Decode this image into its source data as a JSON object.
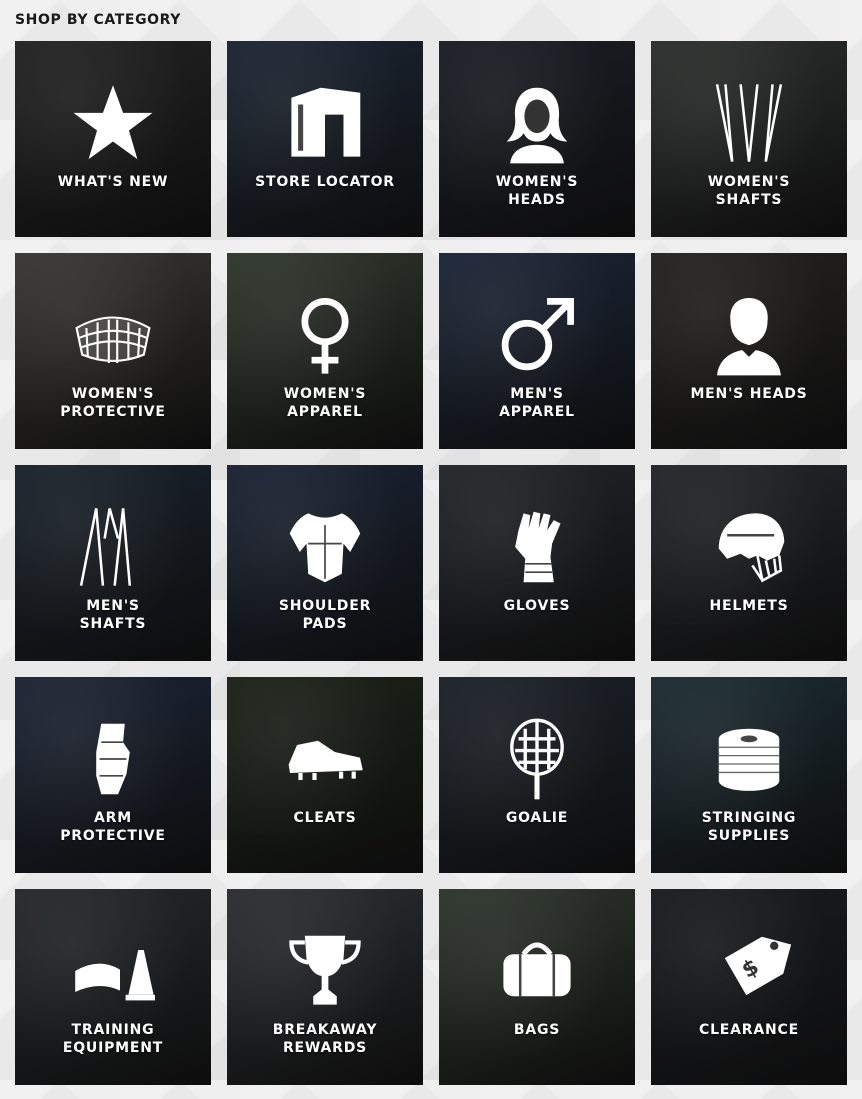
{
  "section_title": "SHOP BY CATEGORY",
  "categories": [
    {
      "label": "WHAT'S NEW",
      "icon": "star-icon",
      "bg": "#3a3a3a"
    },
    {
      "label": "STORE LOCATOR",
      "icon": "storefront-icon",
      "bg": "#2f3e55"
    },
    {
      "label": "WOMEN'S\nHEADS",
      "icon": "woman-head-icon",
      "bg": "#2e3240"
    },
    {
      "label": "WOMEN'S\nSHAFTS",
      "icon": "women-shafts-icon",
      "bg": "#4a4e4c"
    },
    {
      "label": "WOMEN'S\nPROTECTIVE",
      "icon": "goggles-icon",
      "bg": "#5e5a55"
    },
    {
      "label": "WOMEN'S\nAPPAREL",
      "icon": "female-symbol-icon",
      "bg": "#4f5b4a"
    },
    {
      "label": "MEN'S\nAPPAREL",
      "icon": "male-symbol-icon",
      "bg": "#2f3f5e"
    },
    {
      "label": "MEN'S HEADS",
      "icon": "man-head-icon",
      "bg": "#3d3a37"
    },
    {
      "label": "MEN'S\nSHAFTS",
      "icon": "men-shafts-icon",
      "bg": "#2c3a4a"
    },
    {
      "label": "SHOULDER\nPADS",
      "icon": "shoulder-pads-icon",
      "bg": "#2d3b57"
    },
    {
      "label": "GLOVES",
      "icon": "glove-icon",
      "bg": "#3a3d43"
    },
    {
      "label": "HELMETS",
      "icon": "helmet-icon",
      "bg": "#3c3f46"
    },
    {
      "label": "ARM\nPROTECTIVE",
      "icon": "arm-pad-icon",
      "bg": "#2f3d59"
    },
    {
      "label": "CLEATS",
      "icon": "cleat-icon",
      "bg": "#2f3a2a"
    },
    {
      "label": "GOALIE",
      "icon": "goalie-head-icon",
      "bg": "#2f3946"
    },
    {
      "label": "STRINGING\nSUPPLIES",
      "icon": "string-spool-icon",
      "bg": "#2f4a55"
    },
    {
      "label": "TRAINING\nEQUIPMENT",
      "icon": "training-cone-icon",
      "bg": "#3f4448"
    },
    {
      "label": "BREAKAWAY\nREWARDS",
      "icon": "trophy-icon",
      "bg": "#4a4d52"
    },
    {
      "label": "BAGS",
      "icon": "duffel-bag-icon",
      "bg": "#4c5a4a"
    },
    {
      "label": "CLEARANCE",
      "icon": "price-tag-icon",
      "bg": "#2b2f34"
    }
  ]
}
